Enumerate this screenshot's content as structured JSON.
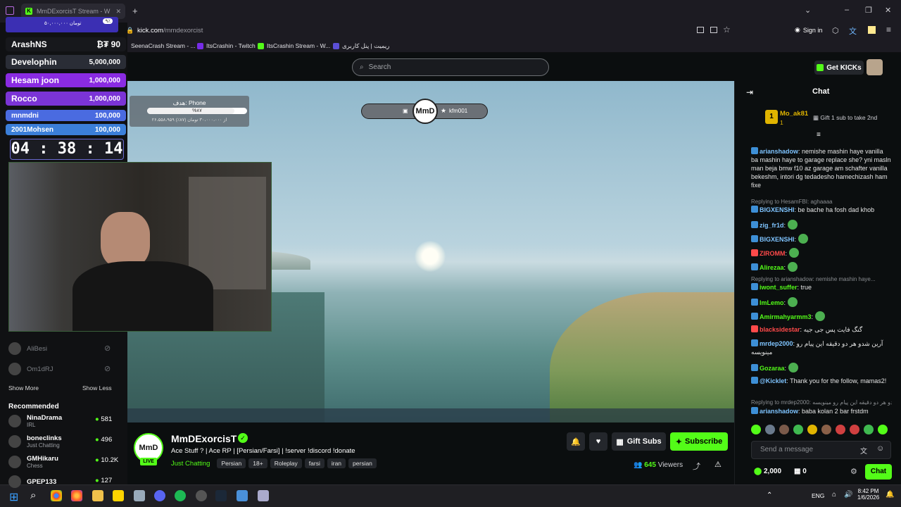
{
  "browser": {
    "tab_title": "MmDExorcisT Stream - W",
    "url_host": "kick.com",
    "url_path": "/mmdexorcist",
    "bookmarks": [
      {
        "label": "SeenaCrash Stream - ..."
      },
      {
        "label": "ItsCrashin - Twitch"
      },
      {
        "label": "ItsCrashin Stream - W..."
      },
      {
        "label": "ریمیت | پنل کاربری"
      }
    ],
    "sign_in": "Sign in"
  },
  "header": {
    "search_placeholder": "Search",
    "get_kicks": "Get KICKs"
  },
  "overlay": {
    "donation_title": "ArashNS",
    "donation_amount": "₿₮ 90",
    "top_hint": "۵۰,۰۰۰,۰۰۰ تومان",
    "top_pct": "۹٪",
    "leaderboard": [
      {
        "name": "Develophin",
        "amount": "5,000,000",
        "color": "#2a2d36"
      },
      {
        "name": "Hesam joon",
        "amount": "1,000,000",
        "color": "#8a2be2"
      },
      {
        "name": "Rocco",
        "amount": "1,000,000",
        "color": "#7b34d6"
      },
      {
        "name": "mnmdni",
        "amount": "100,000",
        "color": "#4a6be0"
      },
      {
        "name": "2001Mohsen",
        "amount": "100,000",
        "color": "#3b7fd9"
      }
    ],
    "timer": "04 : 38 : 14",
    "goal_title": "هدف: Phone",
    "goal_pct": "%۸۷",
    "goal_sub": "۲۶،۵۵۸،۹۵۹ از ۳۰،۰۰۰،۰۰۰ تومان (۸۷٪)",
    "goal_fill": 0.87,
    "pill_user": "kfm001",
    "logo": "MmD"
  },
  "sidebar": {
    "followed": [
      {
        "name": "AliBesi"
      },
      {
        "name": "Om1dRJ"
      }
    ],
    "show_more": "Show More",
    "show_less": "Show Less",
    "recommended_title": "Recommended",
    "recommended": [
      {
        "name": "NinaDrama",
        "category": "IRL",
        "viewers": "581"
      },
      {
        "name": "boneclinks",
        "category": "Just Chatting",
        "viewers": "496"
      },
      {
        "name": "GMHikaru",
        "category": "Chess",
        "viewers": "10.2K"
      },
      {
        "name": "GPEP133",
        "category": "",
        "viewers": "127"
      }
    ]
  },
  "stream": {
    "channel": "MmDExorcisT",
    "title": "Ace Stuff ? | Ace RP | [Persian/Farsi] | !server !discord !donate",
    "category": "Just Chatting",
    "tags": [
      "Persian",
      "18+",
      "Roleplay",
      "farsi",
      "iran",
      "persian"
    ],
    "live": "LIVE",
    "gift_subs": "Gift Subs",
    "subscribe": "Subscribe",
    "viewers": "645",
    "viewers_label": "Viewers"
  },
  "chat": {
    "title": "Chat",
    "pinned_user": "Mo_ak81",
    "pinned_count": "1",
    "pinned_text": "Gift 1 sub to take 2nd",
    "messages": [
      {
        "user": "arianshadow",
        "text": "nemishe mashin haye vanilla ba mashin haye to garage replace she? yni masln man beja bmw f10 az garage am schafter vanilla bekeshm, intori dg tedadesho hamechizash ham fixe",
        "color": "#7fc4ff"
      },
      {
        "reply": "Replying to HesamFBI: aghaaaa"
      },
      {
        "user": "BIGXENSHI",
        "text": "be bache ha fosh dad khob",
        "color": "#7fc4ff"
      },
      {
        "user": "zig_fr1d",
        "text": "",
        "color": "#7fc4ff"
      },
      {
        "user": "BIGXENSHI",
        "text": "",
        "color": "#7fc4ff"
      },
      {
        "user": "ZIROMM",
        "text": "",
        "color": "#ff4a4a"
      },
      {
        "user": "Alirezaa",
        "text": "",
        "color": "#53fc18"
      },
      {
        "reply": "Replying to arianshadow: nemishe mashin haye..."
      },
      {
        "user": "iwont_suffer",
        "text": "true",
        "color": "#53fc18"
      },
      {
        "user": "ImLemo",
        "text": "",
        "color": "#53fc18"
      },
      {
        "user": "Amirmahyarmm3",
        "text": "",
        "color": "#53fc18"
      },
      {
        "user": "blacksidestar",
        "text": "گنگ فایت پس جی جیه",
        "color": "#ff4a4a"
      },
      {
        "user": "mrdep2000",
        "text": "آرین شدو هر دو دقیقه این پیام رو مینویسه",
        "color": "#7fc4ff"
      },
      {
        "user": "Gozaraa",
        "text": "",
        "color": "#53fc18"
      },
      {
        "user": "@Kicklet",
        "text": "Thank you for the follow, mamas2!",
        "color": "#7fc4ff"
      },
      {
        "reply": "Replying to mrdep2000: آرین شدو هر دو دقیقه این پیام رو مینویسه"
      },
      {
        "user": "arianshadow",
        "text": "baba kolan 2 bar frstdm",
        "color": "#7fc4ff"
      }
    ],
    "input_placeholder": "Send a message",
    "points": "2,000",
    "gifts": "0",
    "send": "Chat"
  },
  "taskbar": {
    "lang": "ENG",
    "time": "8:42 PM",
    "date": "1/6/2026"
  }
}
